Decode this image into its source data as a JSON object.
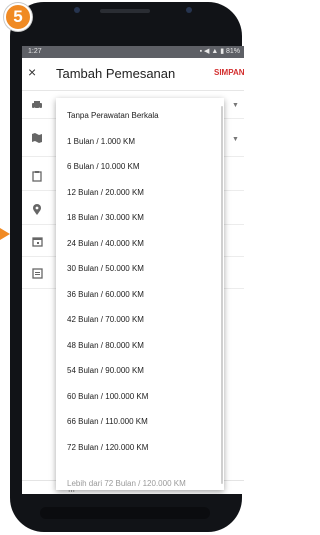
{
  "step_badge": "5",
  "status_bar": {
    "time": "1:27",
    "icons": "▪ ◀ ▲ ▮ 81%"
  },
  "app_bar": {
    "close_icon": "×",
    "title": "Tambah Pemesanan",
    "save_label": "SIMPAN"
  },
  "form_icons": [
    "car-icon",
    "map-icon",
    "clipboard-icon",
    "location-pin-icon",
    "calendar-icon",
    "notes-icon"
  ],
  "dropdown": {
    "items": [
      "Tanpa Perawatan Berkala",
      "1 Bulan / 1.000 KM",
      "6 Bulan / 10.000 KM",
      "12 Bulan / 20.000 KM",
      "18 Bulan / 30.000 KM",
      "24 Bulan / 40.000 KM",
      "30 Bulan / 50.000 KM",
      "36 Bulan / 60.000 KM",
      "42 Bulan / 70.000 KM",
      "48 Bulan / 80.000 KM",
      "54 Bulan / 90.000 KM",
      "60 Bulan / 100.000 KM",
      "66 Bulan / 110.000 KM",
      "72 Bulan / 120.000 KM",
      "Lebih dari 72 Bulan / 120.000 KM"
    ]
  },
  "nav_bar": {
    "recents": "|||",
    "home": "○",
    "back": "<"
  },
  "colors": {
    "accent": "#f08a24",
    "save": "#d32f2f"
  }
}
